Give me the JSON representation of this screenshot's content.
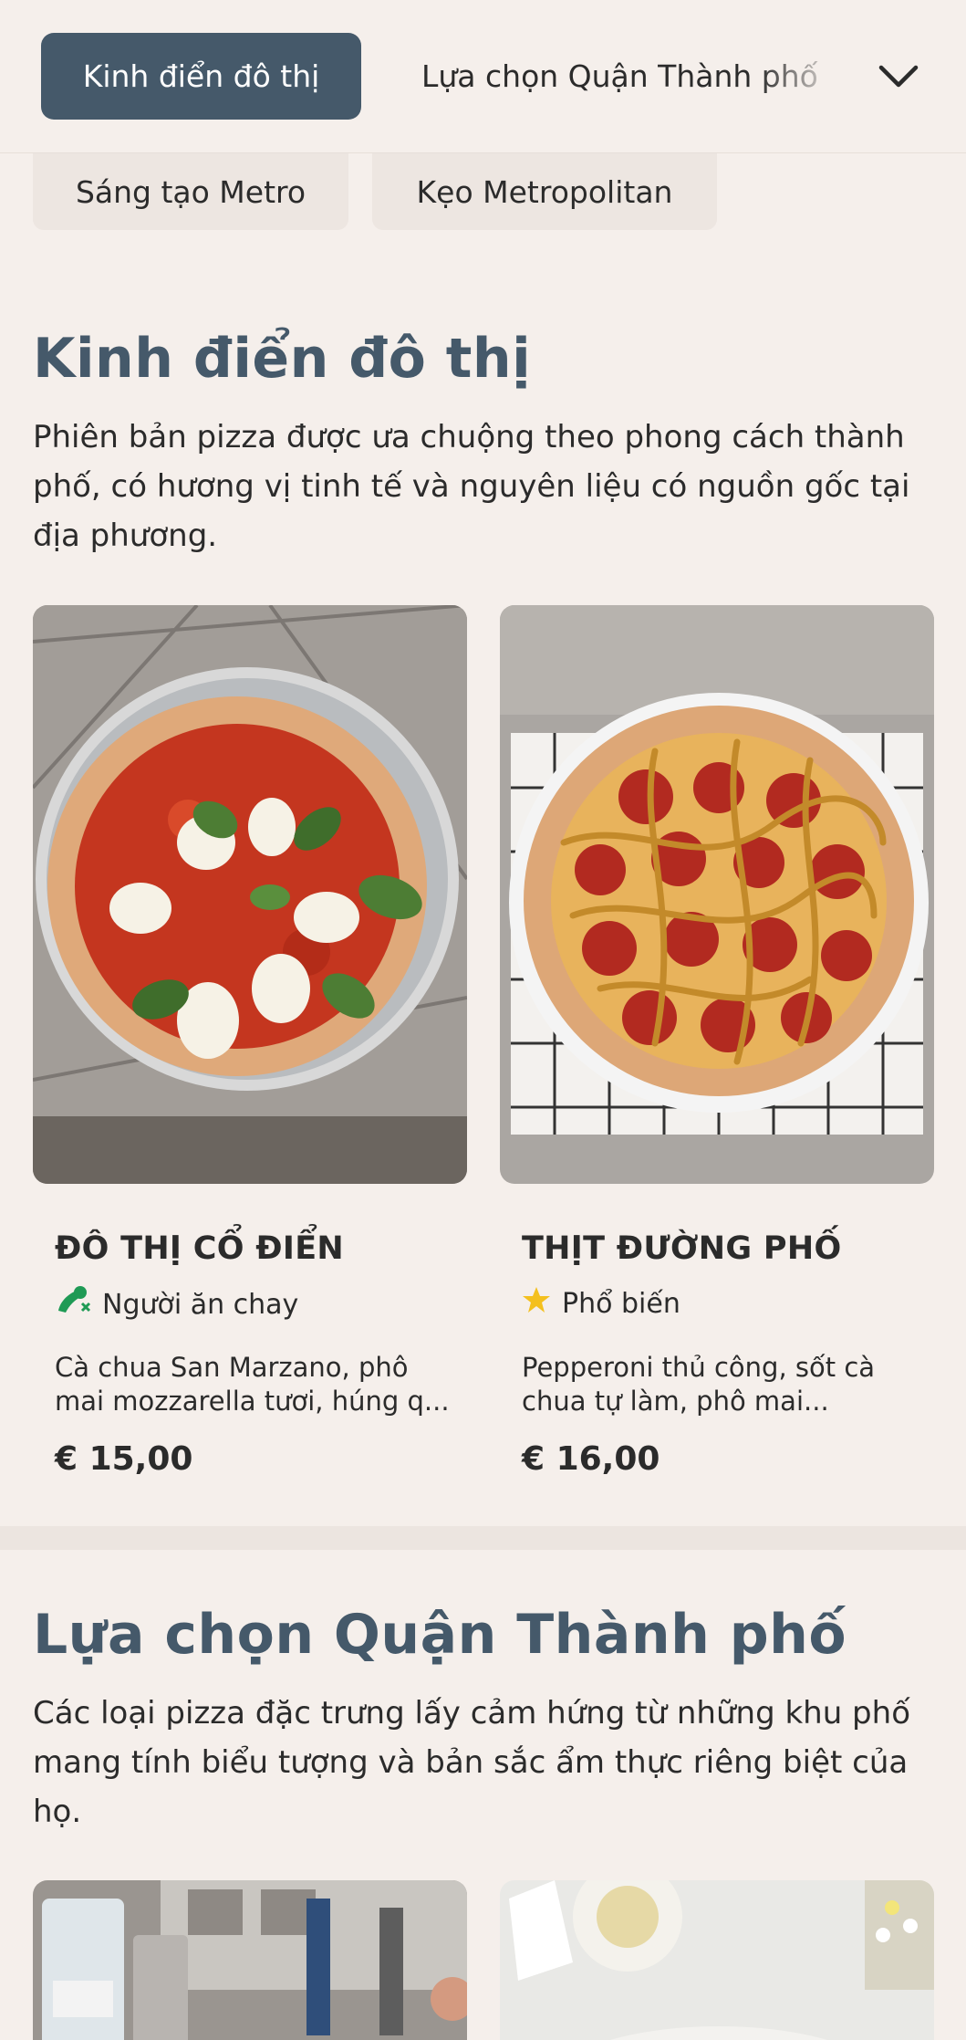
{
  "tabs": {
    "active_label": "Kinh điển đô thị",
    "next_label": "Lựa chọn Quận Thành phố",
    "chips": [
      "Sáng tạo Metro",
      "Kẹo Metropolitan"
    ]
  },
  "sections": [
    {
      "title": "Kinh điển đô thị",
      "description": "Phiên bản pizza được ưa chuộng theo phong cách thành phố, có hương vị tinh tế và nguyên liệu có nguồn gốc tại địa phương.",
      "items": [
        {
          "name": "ĐÔ THỊ CỔ ĐIỂN",
          "tag": "Người ăn chay",
          "tag_icon": "vegetarian-icon",
          "desc_line1": "Cà chua San Marzano, phô",
          "desc_line2": "mai mozzarella tươi, húng q...",
          "price": "€ 15,00"
        },
        {
          "name": "THỊT ĐƯỜNG PHỐ",
          "tag": "Phổ biến",
          "tag_icon": "star-icon",
          "desc_line1": "Pepperoni thủ công, sốt cà",
          "desc_line2": "chua tự làm, phô mai...",
          "price": "€ 16,00"
        }
      ]
    },
    {
      "title": "Lựa chọn Quận Thành phố",
      "description": "Các loại pizza đặc trưng lấy cảm hứng từ những khu phố mang tính biểu tượng và bản sắc ẩm thực riêng biệt của họ."
    }
  ],
  "colors": {
    "accent": "#45596a",
    "background": "#f5efeb",
    "chip_bg": "#ede6e1",
    "veg_green": "#1f9a55",
    "star_yellow": "#f4c01e"
  }
}
